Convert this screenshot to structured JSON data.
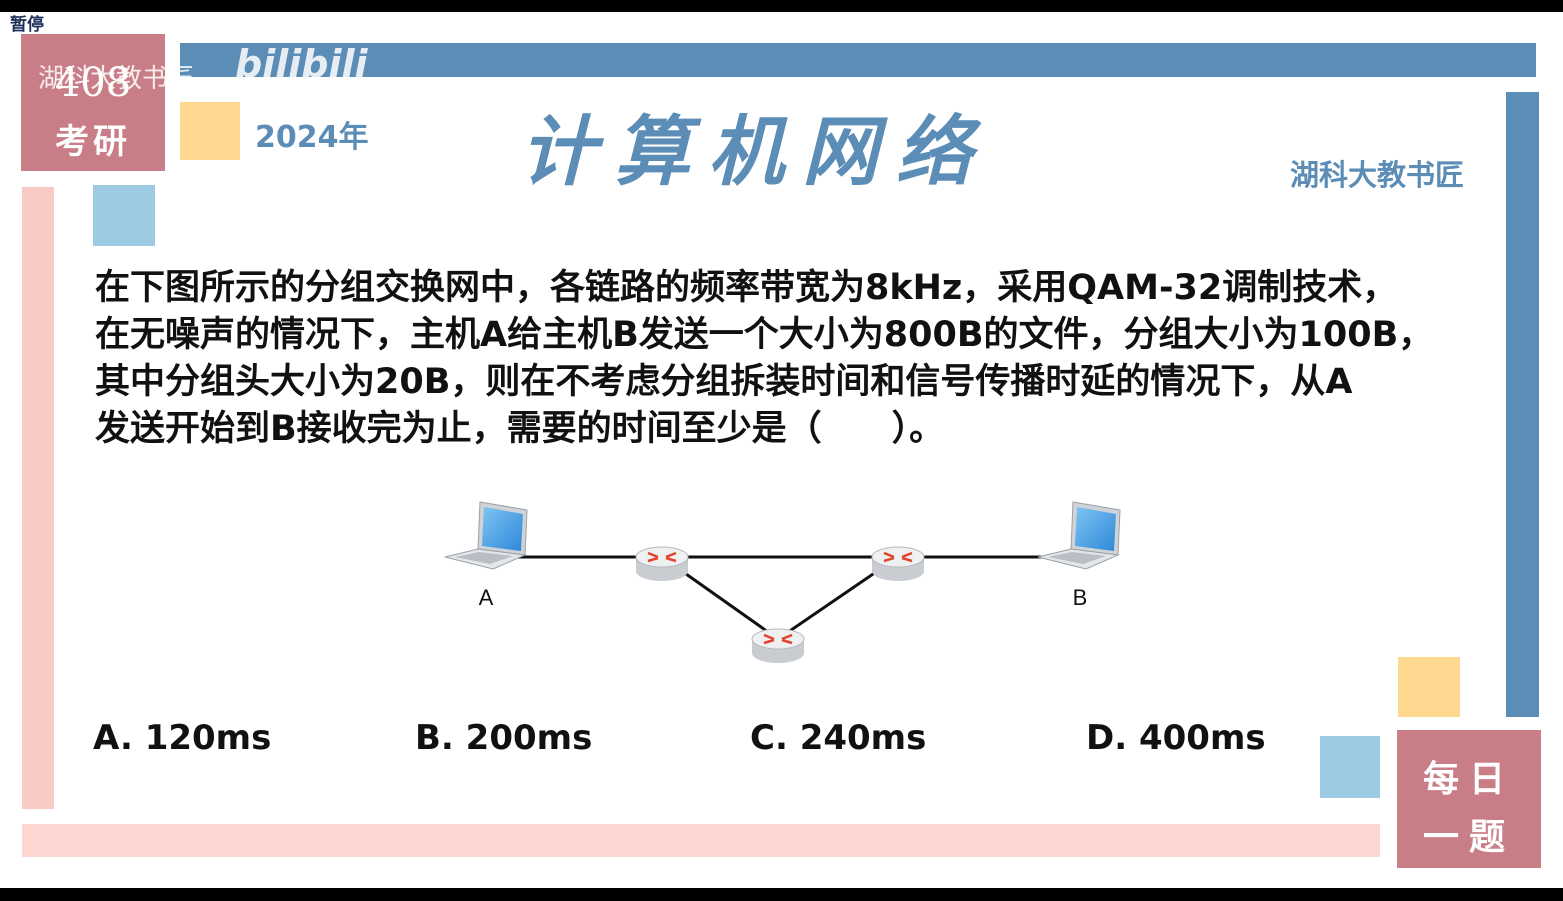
{
  "overlay": {
    "pause_label": "暂停"
  },
  "badge_top_left": {
    "number": "408",
    "text": "考研"
  },
  "watermark": {
    "text": "湖科大教书匠",
    "logo": "bilibili"
  },
  "header": {
    "year": "2024年",
    "title": "计算机网络",
    "author": "湖科大教书匠"
  },
  "question": {
    "lines": [
      "在下图所示的分组交换网中，各链路的频率带宽为8kHz，采用QAM-32调制技术，",
      "在无噪声的情况下，主机A给主机B发送一个大小为800B的文件，分组大小为100B，",
      "其中分组头大小为20B，则在不考虑分组拆装时间和信号传播时延的情况下，从A",
      "发送开始到B接收完为止，需要的时间至少是（　　）。"
    ]
  },
  "diagram": {
    "host_a_label": "A",
    "host_b_label": "B"
  },
  "options": [
    "A. 120ms",
    "B. 200ms",
    "C. 240ms",
    "D. 400ms"
  ],
  "badge_bottom_right": {
    "line1": "每日",
    "line2": "一题"
  },
  "colors": {
    "blue": "#5b8db7",
    "pink": "#c97d86",
    "light_pink": "#f9c9c4",
    "yellow": "#fed88f",
    "light_blue": "#9bcae2"
  }
}
